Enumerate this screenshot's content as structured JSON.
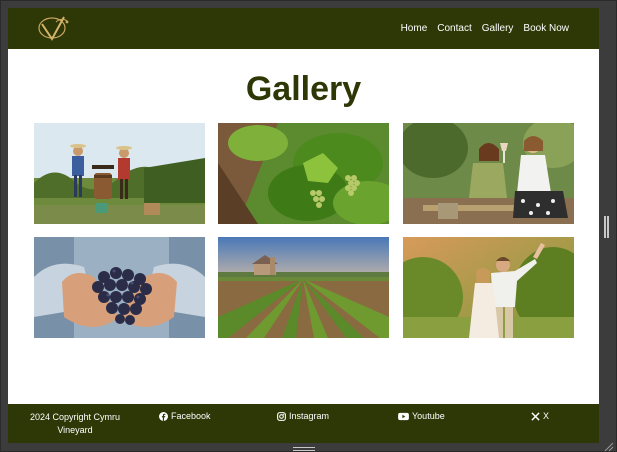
{
  "header": {
    "logo_icon": "vineyard-monogram-logo",
    "nav": [
      "Home",
      "Contact",
      "Gallery",
      "Book Now"
    ]
  },
  "main": {
    "title": "Gallery",
    "photos": [
      {
        "icon": "harvest-couple-photo"
      },
      {
        "icon": "vine-grapes-photo"
      },
      {
        "icon": "wine-toast-photo"
      },
      {
        "icon": "hands-grapes-photo"
      },
      {
        "icon": "vineyard-rows-photo"
      },
      {
        "icon": "couple-vineyard-photo"
      }
    ]
  },
  "footer": {
    "copyright": "2024 Copyright Cymru Vineyard",
    "links": [
      "Facebook",
      "Instagram",
      "Youtube",
      "X"
    ]
  },
  "colors": {
    "brand": "#2e3807",
    "background": "#ffffff",
    "frame": "#3c3c3c"
  }
}
